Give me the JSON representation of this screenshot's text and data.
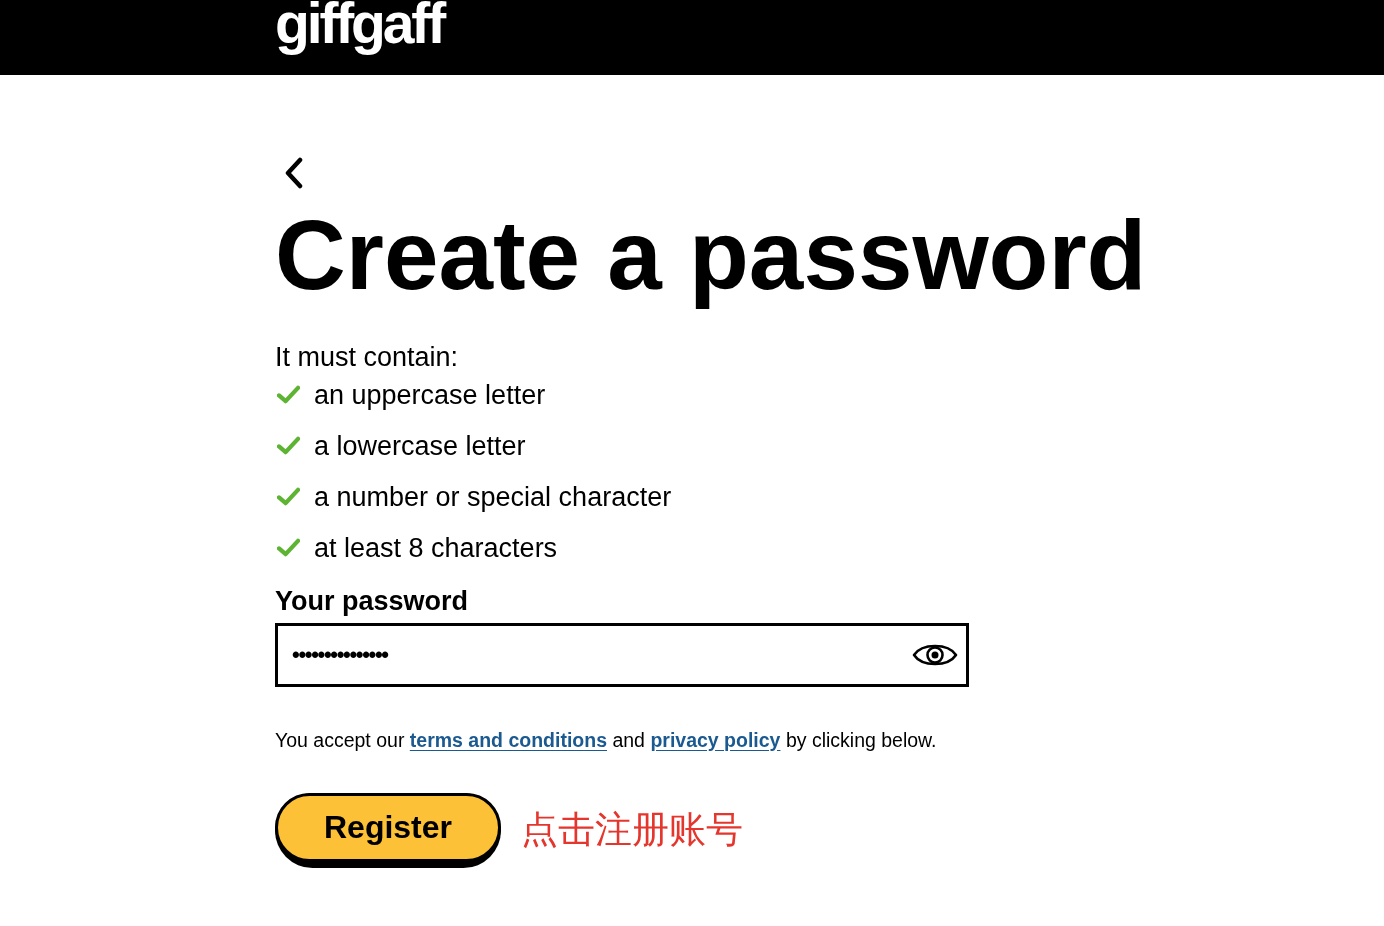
{
  "header": {
    "logo": "giffgaff"
  },
  "title": "Create a password",
  "requirements": {
    "intro": "It must contain:",
    "items": [
      {
        "text": "an uppercase letter",
        "checked": true
      },
      {
        "text": "a lowercase letter",
        "checked": true
      },
      {
        "text": "a number or special character",
        "checked": true
      },
      {
        "text": "at least 8 characters",
        "checked": true
      }
    ]
  },
  "password_field": {
    "label": "Your password",
    "value": "•••••••••••••••"
  },
  "terms": {
    "segments": [
      {
        "kind": "text",
        "text": "You accept our"
      },
      {
        "kind": "link",
        "text": "terms and conditions"
      },
      {
        "kind": "text",
        "text": "and"
      },
      {
        "kind": "link",
        "text": "privacy policy"
      },
      {
        "kind": "text",
        "text": "by clicking below."
      }
    ]
  },
  "register_button": {
    "label": "Register"
  },
  "annotation": "点击注册账号"
}
